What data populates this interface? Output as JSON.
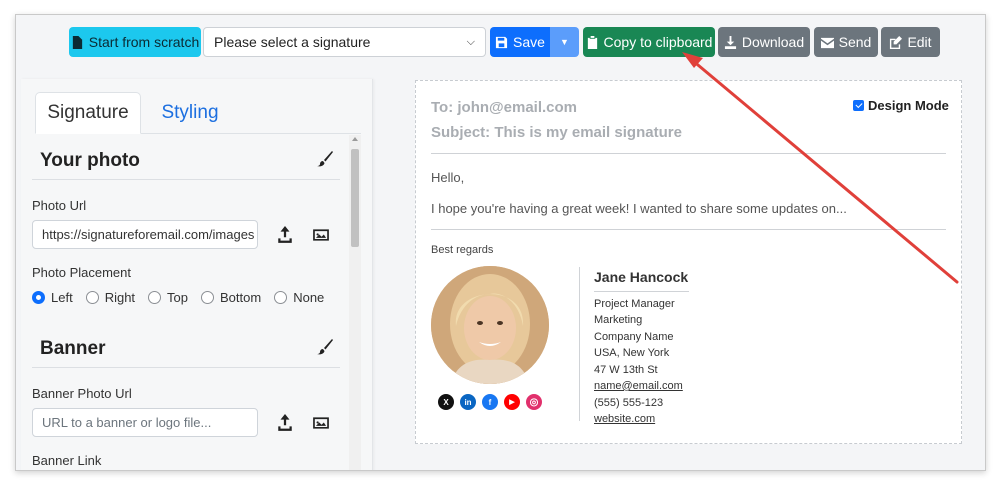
{
  "toolbar": {
    "start_label": "Start from scratch",
    "select_value": "Please select a signature",
    "save_label": "Save",
    "copy_label": "Copy to clipboard",
    "download_label": "Download",
    "send_label": "Send",
    "edit_label": "Edit"
  },
  "editor": {
    "tabs": [
      "Signature",
      "Styling"
    ],
    "photo_section": {
      "title": "Your photo",
      "url_label": "Photo Url",
      "url_value": "https://signatureforemail.com/images",
      "placement_label": "Photo Placement",
      "placements": [
        "Left",
        "Right",
        "Top",
        "Bottom",
        "None"
      ],
      "selected_placement": "Left"
    },
    "banner_section": {
      "title": "Banner",
      "url_label": "Banner Photo Url",
      "url_placeholder": "URL to a banner or logo file...",
      "link_label": "Banner Link"
    }
  },
  "preview": {
    "to": "To: john@email.com",
    "subject": "Subject: This is my email signature",
    "design_mode_label": "Design Mode",
    "design_mode_checked": true,
    "greeting": "Hello,",
    "body": "I hope you're having a great week! I wanted to share some updates on...",
    "closing": "Best regards",
    "signature": {
      "name": "Jane Hancock",
      "title": "Project Manager",
      "department": "Marketing",
      "company": "Company Name",
      "location": "USA, New York",
      "address": "47 W 13th St",
      "email": "name@email.com",
      "phone": "(555) 555-123",
      "website": "website.com"
    },
    "socials": [
      {
        "icon": "x-icon",
        "label": "X",
        "color": "#111111"
      },
      {
        "icon": "linkedin-icon",
        "label": "in",
        "color": "#0a66c2"
      },
      {
        "icon": "facebook-icon",
        "label": "f",
        "color": "#1877f2"
      },
      {
        "icon": "youtube-icon",
        "label": "▶",
        "color": "#ff0000"
      },
      {
        "icon": "instagram-icon",
        "label": "◎",
        "color": "#e1306c"
      }
    ]
  },
  "colors": {
    "primary": "#0d6efd",
    "success": "#198754",
    "secondary": "#6c757d",
    "info": "#1cc8ee",
    "annotation": "#e0403a"
  }
}
